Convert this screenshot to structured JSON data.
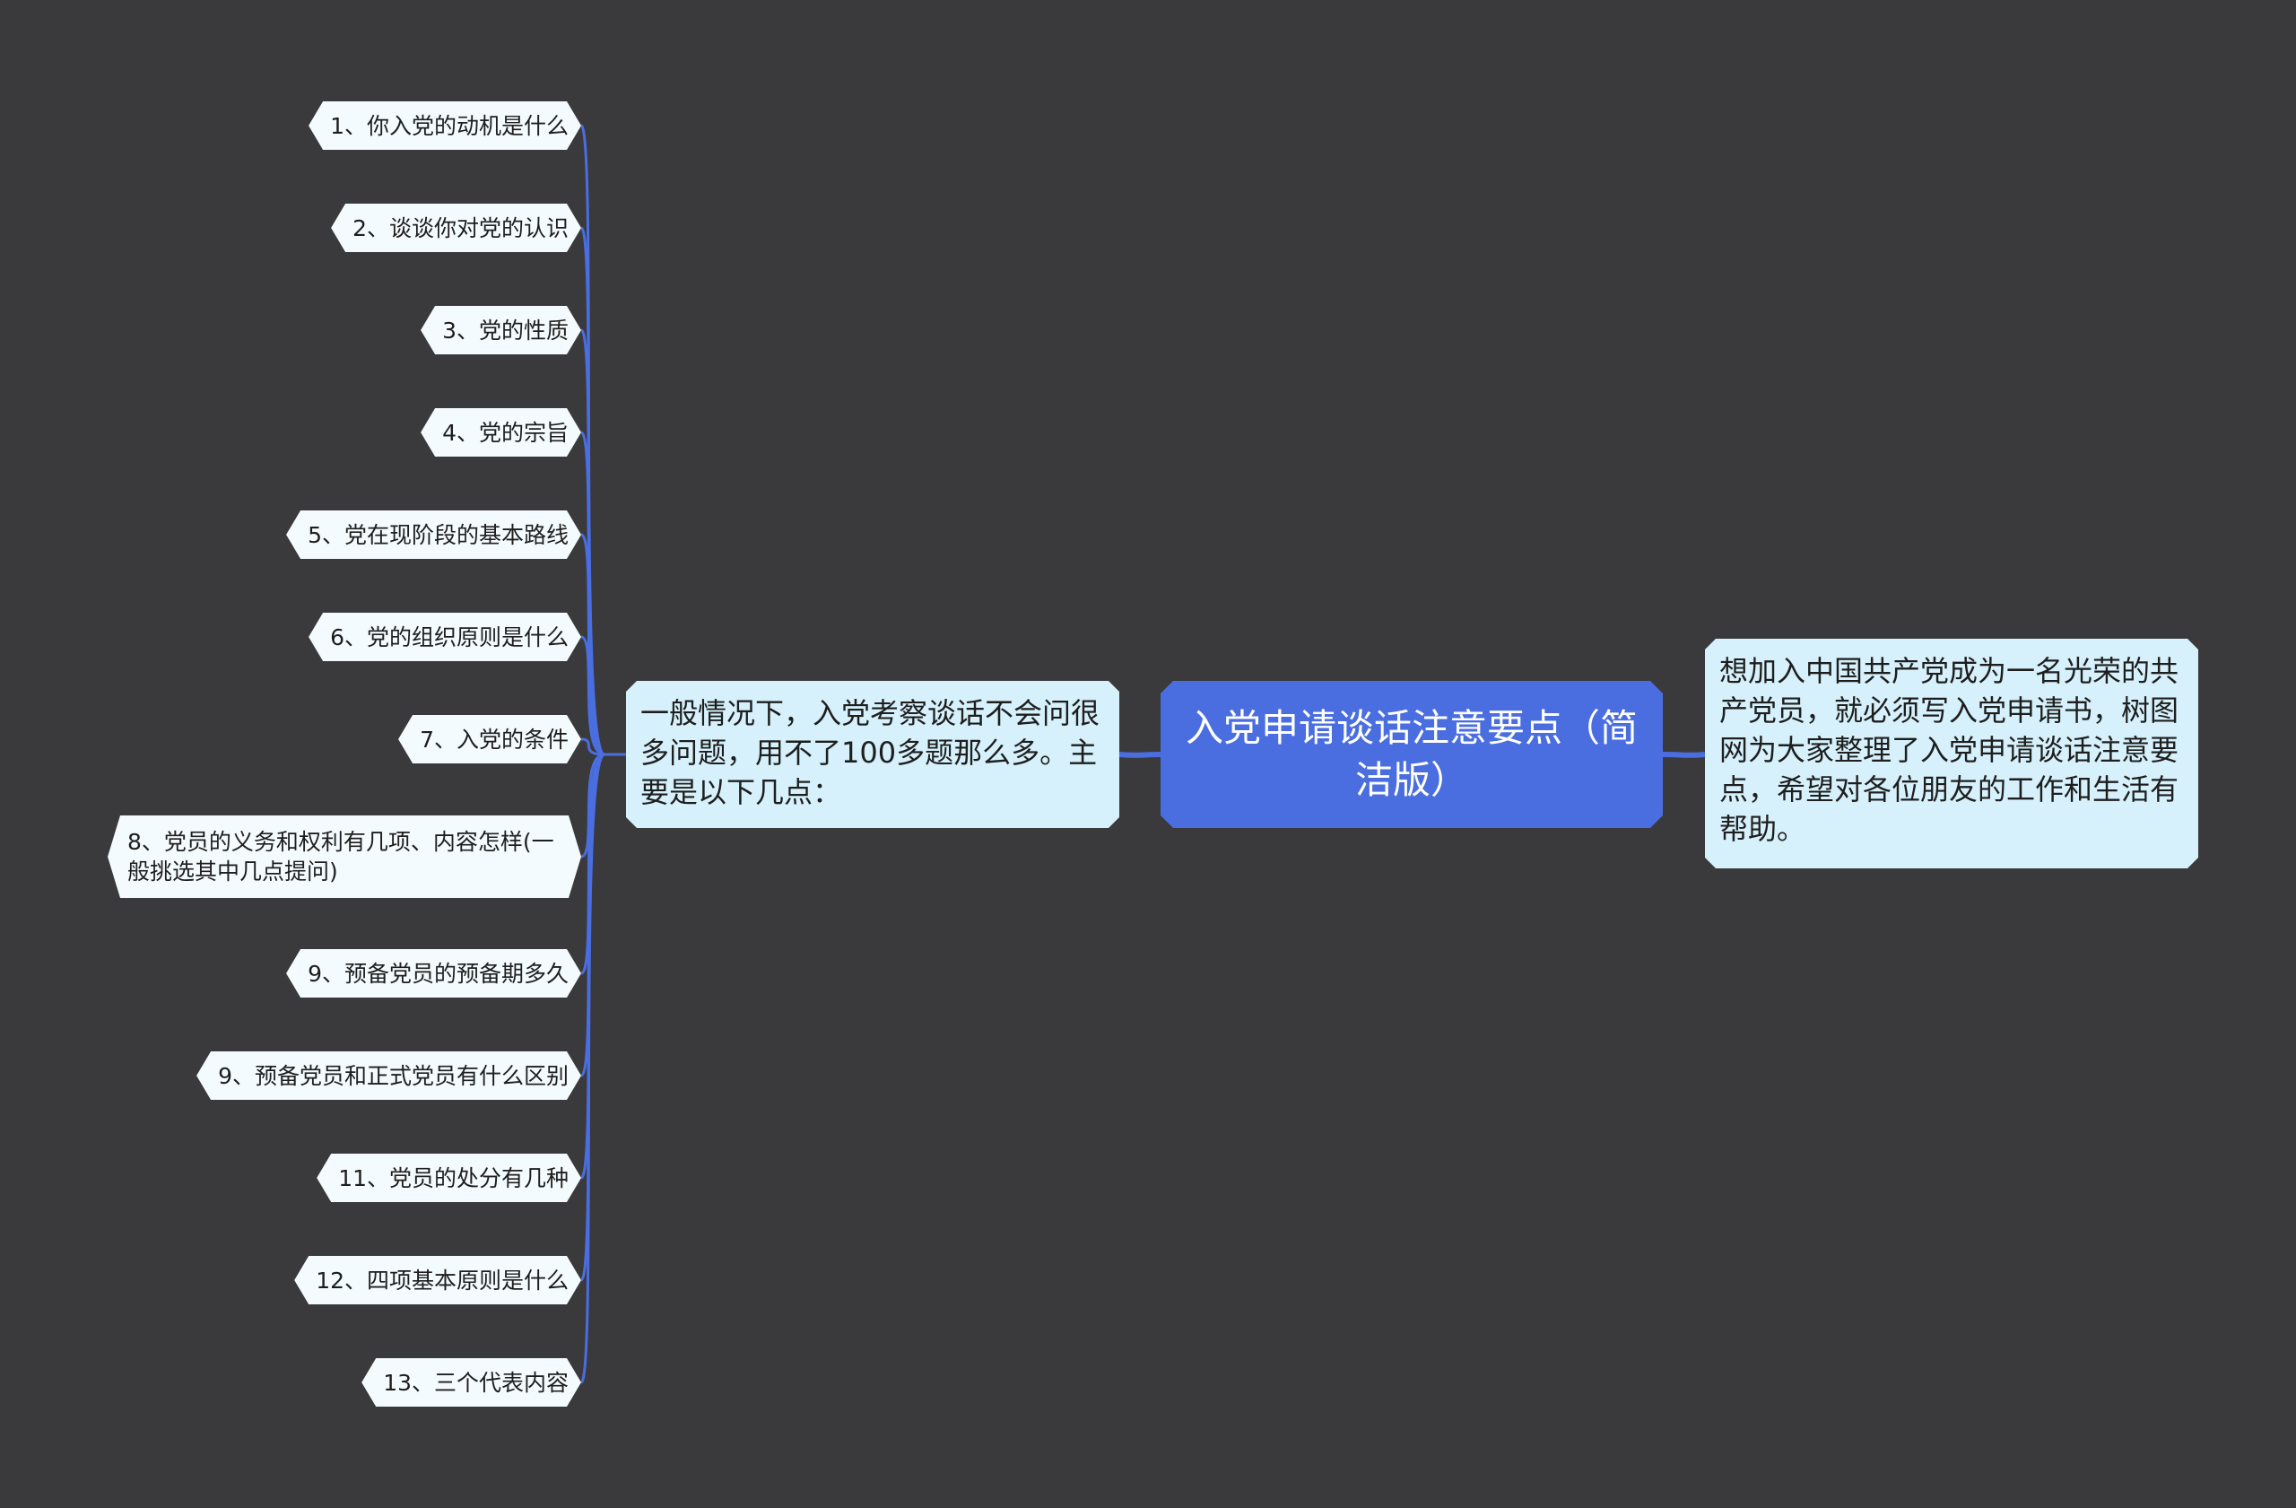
{
  "root": {
    "title": "入党申请谈话注意要点（简洁版）"
  },
  "left_branch": {
    "text": "一般情况下，入党考察谈话不会问很多问题，用不了100多题那么多。主要是以下几点："
  },
  "right_branch": {
    "text": "想加入中国共产党成为一名光荣的共产党员，就必须写入党申请书，树图网为大家整理了入党申请谈话注意要点，希望对各位朋友的工作和生活有帮助。"
  },
  "leaves": [
    "1、你入党的动机是什么",
    "2、谈谈你对党的认识",
    "3、党的性质",
    "4、党的宗旨",
    "5、党在现阶段的基本路线",
    "6、党的组织原则是什么",
    "7、入党的条件",
    "8、党员的义务和权利有几项、内容怎样(一般挑选其中几点提问)",
    "9、预备党员的预备期多久",
    "9、预备党员和正式党员有什么区别",
    "11、党员的处分有几种",
    "12、四项基本原则是什么",
    "13、三个代表内容"
  ],
  "colors": {
    "background": "#3a393b",
    "root_fill": "#4a6ee0",
    "branch_fill": "#d6f1fb",
    "leaf_fill": "#f4fbfe",
    "connector": "#4a6ee0"
  }
}
